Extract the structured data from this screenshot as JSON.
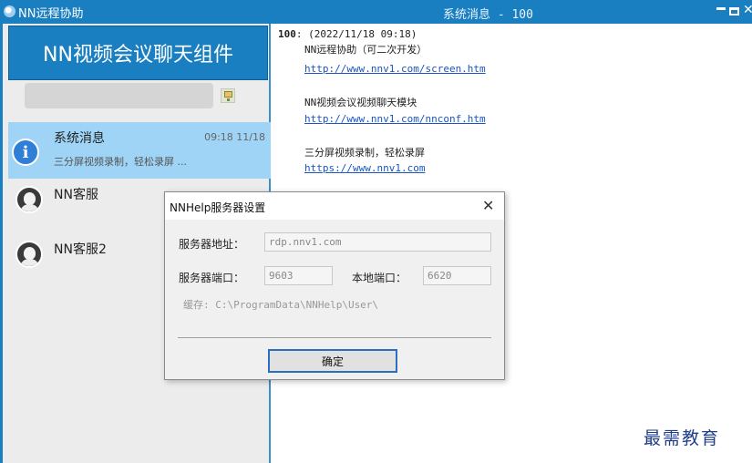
{
  "titlebar": {
    "app_name": "NN远程协助",
    "title": "系统消息 - 100",
    "close_glyph": "✕"
  },
  "left_panel": {
    "header": "NN视频会议聊天组件",
    "contacts": [
      {
        "name": "系统消息",
        "time": "09:18 11/18",
        "preview": "三分屏视频录制，轻松录屏 ...",
        "icon": "info-icon",
        "active": true
      },
      {
        "name": "NN客服",
        "icon": "avatar-icon"
      },
      {
        "name": "NN客服2",
        "icon": "avatar-icon"
      }
    ]
  },
  "message": {
    "sender_id": "100",
    "timestamp": ":  (2022/11/18 09:18)",
    "lines": [
      {
        "text": "NN远程协助（可二次开发）"
      },
      {
        "link": "http://www.nnv1.com/screen.htm"
      },
      {
        "text": "NN视频会议视频聊天模块"
      },
      {
        "link": "http://www.nnv1.com/nnconf.htm"
      },
      {
        "text": "三分屏视频录制，轻松录屏"
      },
      {
        "link": "https://www.nnv1.com"
      }
    ]
  },
  "dialog": {
    "title": "NNHelp服务器设置",
    "close_glyph": "✕",
    "server_address_label": "服务器地址：",
    "server_address_value": "rdp.nnv1.com",
    "server_port_label": "服务器端口：",
    "server_port_value": "9603",
    "local_port_label": "本地端口：",
    "local_port_value": "6620",
    "cache_text": "缓存: C:\\ProgramData\\NNHelp\\User\\",
    "ok_label": "确定"
  },
  "watermark": "最需教育",
  "colors": {
    "accent": "#1a7fc0",
    "active_item": "#9fd4f6",
    "link": "#1a55c0"
  }
}
